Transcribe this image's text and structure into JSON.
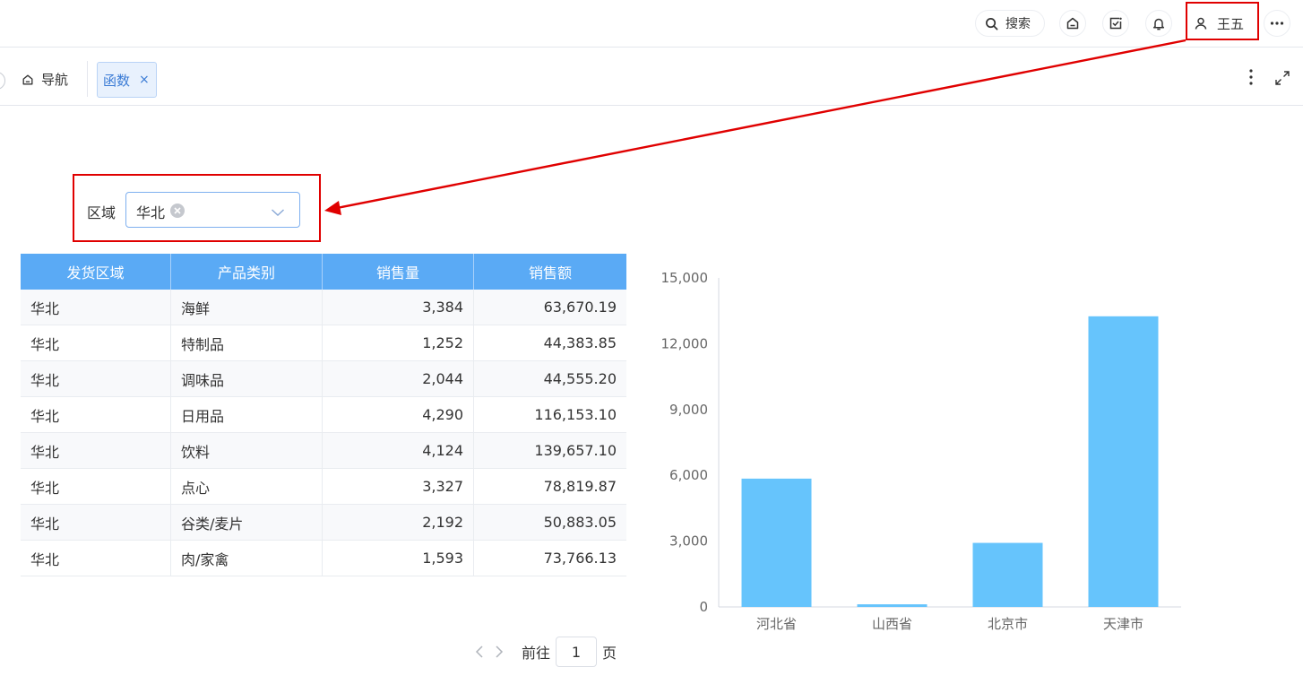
{
  "topbar": {
    "search_label": "搜索",
    "user_name": "王五"
  },
  "tabs": {
    "nav_label": "导航",
    "active_tab_label": "函数",
    "close_glyph": "×"
  },
  "filter": {
    "label": "区域",
    "selected_value": "华北"
  },
  "table": {
    "headers": [
      "发货区域",
      "产品类别",
      "销售量",
      "销售额"
    ],
    "rows": [
      [
        "华北",
        "海鲜",
        "3,384",
        "63,670.19"
      ],
      [
        "华北",
        "特制品",
        "1,252",
        "44,383.85"
      ],
      [
        "华北",
        "调味品",
        "2,044",
        "44,555.20"
      ],
      [
        "华北",
        "日用品",
        "4,290",
        "116,153.10"
      ],
      [
        "华北",
        "饮料",
        "4,124",
        "139,657.10"
      ],
      [
        "华北",
        "点心",
        "3,327",
        "78,819.87"
      ],
      [
        "华北",
        "谷类/麦片",
        "2,192",
        "50,883.05"
      ],
      [
        "华北",
        "肉/家禽",
        "1,593",
        "73,766.13"
      ]
    ]
  },
  "pager": {
    "prefix": "前往",
    "page": "1",
    "suffix": "页"
  },
  "colors": {
    "header_blue": "#5aaaf5",
    "bar_blue": "#66c4fc",
    "highlight_red": "#e00000",
    "tab_active_text": "#3a7bd5"
  },
  "chart_data": {
    "type": "bar",
    "categories": [
      "河北省",
      "山西省",
      "北京市",
      "天津市"
    ],
    "values": [
      5850,
      120,
      2920,
      13250
    ],
    "ylim": [
      0,
      15000
    ],
    "yticks": [
      "0",
      "3,000",
      "6,000",
      "9,000",
      "12,000",
      "15,000"
    ],
    "title": "",
    "xlabel": "",
    "ylabel": "",
    "grid": false
  }
}
